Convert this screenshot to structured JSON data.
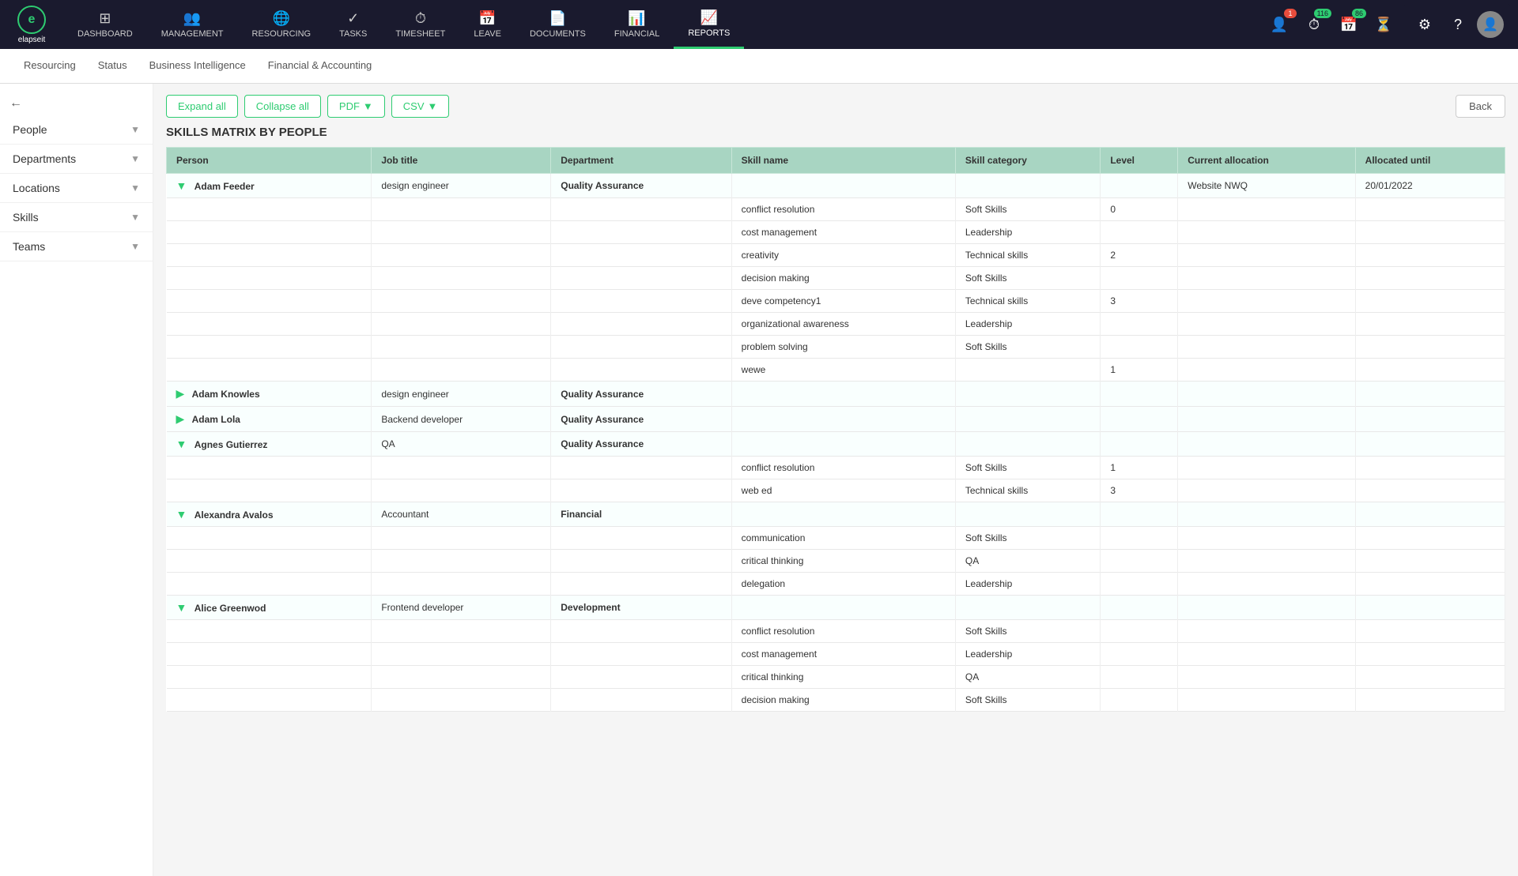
{
  "app": {
    "name": "elapseit"
  },
  "topnav": {
    "items": [
      {
        "id": "dashboard",
        "label": "DASHBOARD",
        "icon": "⊞"
      },
      {
        "id": "management",
        "label": "MANAGEMENT",
        "icon": "👥"
      },
      {
        "id": "resourcing",
        "label": "RESOURCING",
        "icon": "🌐"
      },
      {
        "id": "tasks",
        "label": "TASKS",
        "icon": "✓"
      },
      {
        "id": "timesheet",
        "label": "TIMESHEET",
        "icon": "⏱"
      },
      {
        "id": "leave",
        "label": "LEAVE",
        "icon": "📅"
      },
      {
        "id": "documents",
        "label": "DOCUMENTS",
        "icon": "📄"
      },
      {
        "id": "financial",
        "label": "FINANCIAL",
        "icon": "📊"
      },
      {
        "id": "reports",
        "label": "REPORTS",
        "icon": "📈",
        "active": true
      }
    ],
    "badges": {
      "people_count": "1",
      "timer_count": "116",
      "calendar_count": "86"
    }
  },
  "subnav": {
    "tabs": [
      {
        "id": "resourcing",
        "label": "Resourcing"
      },
      {
        "id": "status",
        "label": "Status"
      },
      {
        "id": "bi",
        "label": "Business Intelligence"
      },
      {
        "id": "financial",
        "label": "Financial & Accounting"
      }
    ],
    "back_label": "Back"
  },
  "sidebar": {
    "items": [
      {
        "id": "people",
        "label": "People"
      },
      {
        "id": "departments",
        "label": "Departments"
      },
      {
        "id": "locations",
        "label": "Locations"
      },
      {
        "id": "skills",
        "label": "Skills"
      },
      {
        "id": "teams",
        "label": "Teams"
      }
    ]
  },
  "toolbar": {
    "expand_all": "Expand all",
    "collapse_all": "Collapse all",
    "pdf_label": "PDF",
    "csv_label": "CSV",
    "back_label": "Back"
  },
  "report": {
    "title": "SKILLS MATRIX BY PEOPLE",
    "columns": [
      "Person",
      "Job title",
      "Department",
      "Skill name",
      "Skill category",
      "Level",
      "Current allocation",
      "Allocated until"
    ],
    "rows": [
      {
        "type": "person",
        "name": "Adam Feeder",
        "job_title": "design engineer",
        "department": "Quality Assurance",
        "current_allocation": "Website NWQ",
        "allocated_until": "20/01/2022",
        "expand": "down",
        "skills": [
          {
            "skill_name": "conflict resolution",
            "skill_category": "Soft Skills",
            "level": "0"
          },
          {
            "skill_name": "cost management",
            "skill_category": "Leadership",
            "level": ""
          },
          {
            "skill_name": "creativity",
            "skill_category": "Technical skills",
            "level": "2"
          },
          {
            "skill_name": "decision making",
            "skill_category": "Soft Skills",
            "level": ""
          },
          {
            "skill_name": "deve competency1",
            "skill_category": "Technical skills",
            "level": "3"
          },
          {
            "skill_name": "organizational awareness",
            "skill_category": "Leadership",
            "level": ""
          },
          {
            "skill_name": "problem solving",
            "skill_category": "Soft Skills",
            "level": ""
          },
          {
            "skill_name": "wewe",
            "skill_category": "",
            "level": "1"
          }
        ]
      },
      {
        "type": "person",
        "name": "Adam Knowles",
        "job_title": "design engineer",
        "department": "Quality Assurance",
        "current_allocation": "",
        "allocated_until": "",
        "expand": "right",
        "skills": []
      },
      {
        "type": "person",
        "name": "Adam Lola",
        "job_title": "Backend developer",
        "department": "Quality Assurance",
        "current_allocation": "",
        "allocated_until": "",
        "expand": "right",
        "skills": []
      },
      {
        "type": "person",
        "name": "Agnes Gutierrez",
        "job_title": "QA",
        "department": "Quality Assurance",
        "current_allocation": "",
        "allocated_until": "",
        "expand": "down",
        "skills": [
          {
            "skill_name": "conflict resolution",
            "skill_category": "Soft Skills",
            "level": "1"
          },
          {
            "skill_name": "web ed",
            "skill_category": "Technical skills",
            "level": "3"
          }
        ]
      },
      {
        "type": "person",
        "name": "Alexandra Avalos",
        "job_title": "Accountant",
        "department": "Financial",
        "current_allocation": "",
        "allocated_until": "",
        "expand": "down",
        "skills": [
          {
            "skill_name": "communication",
            "skill_category": "Soft Skills",
            "level": ""
          },
          {
            "skill_name": "critical thinking",
            "skill_category": "QA",
            "level": ""
          },
          {
            "skill_name": "delegation",
            "skill_category": "Leadership",
            "level": ""
          }
        ]
      },
      {
        "type": "person",
        "name": "Alice Greenwod",
        "job_title": "Frontend developer",
        "department": "Development",
        "current_allocation": "",
        "allocated_until": "",
        "expand": "down",
        "skills": [
          {
            "skill_name": "conflict resolution",
            "skill_category": "Soft Skills",
            "level": ""
          },
          {
            "skill_name": "cost management",
            "skill_category": "Leadership",
            "level": ""
          },
          {
            "skill_name": "critical thinking",
            "skill_category": "QA",
            "level": ""
          },
          {
            "skill_name": "decision making",
            "skill_category": "Soft Skills",
            "level": ""
          }
        ]
      }
    ]
  }
}
